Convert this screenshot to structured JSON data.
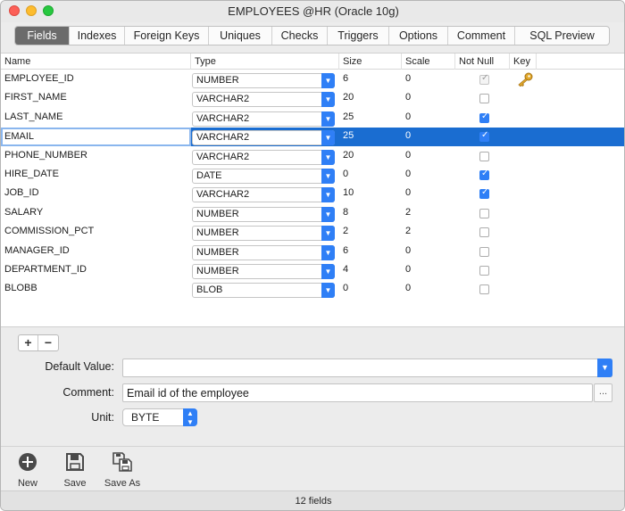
{
  "window": {
    "title": "EMPLOYEES @HR (Oracle 10g)"
  },
  "tabs": [
    {
      "label": "Fields"
    },
    {
      "label": "Indexes"
    },
    {
      "label": "Foreign Keys"
    },
    {
      "label": "Uniques"
    },
    {
      "label": "Checks"
    },
    {
      "label": "Triggers"
    },
    {
      "label": "Options"
    },
    {
      "label": "Comment"
    },
    {
      "label": "SQL Preview"
    }
  ],
  "active_tab": "Fields",
  "grid": {
    "headers": {
      "name": "Name",
      "type": "Type",
      "size": "Size",
      "scale": "Scale",
      "not_null": "Not Null",
      "key": "Key"
    },
    "rows": [
      {
        "name": "EMPLOYEE_ID",
        "type": "NUMBER",
        "size": "6",
        "scale": "0",
        "not_null": true,
        "disabled": true,
        "key": true,
        "selected": false
      },
      {
        "name": "FIRST_NAME",
        "type": "VARCHAR2",
        "size": "20",
        "scale": "0",
        "not_null": false,
        "key": false,
        "selected": false
      },
      {
        "name": "LAST_NAME",
        "type": "VARCHAR2",
        "size": "25",
        "scale": "0",
        "not_null": true,
        "key": false,
        "selected": false
      },
      {
        "name": "EMAIL",
        "type": "VARCHAR2",
        "size": "25",
        "scale": "0",
        "not_null": true,
        "key": false,
        "selected": true
      },
      {
        "name": "PHONE_NUMBER",
        "type": "VARCHAR2",
        "size": "20",
        "scale": "0",
        "not_null": false,
        "key": false,
        "selected": false
      },
      {
        "name": "HIRE_DATE",
        "type": "DATE",
        "size": "0",
        "scale": "0",
        "not_null": true,
        "key": false,
        "selected": false
      },
      {
        "name": "JOB_ID",
        "type": "VARCHAR2",
        "size": "10",
        "scale": "0",
        "not_null": true,
        "key": false,
        "selected": false
      },
      {
        "name": "SALARY",
        "type": "NUMBER",
        "size": "8",
        "scale": "2",
        "not_null": false,
        "key": false,
        "selected": false
      },
      {
        "name": "COMMISSION_PCT",
        "type": "NUMBER",
        "size": "2",
        "scale": "2",
        "not_null": false,
        "key": false,
        "selected": false
      },
      {
        "name": "MANAGER_ID",
        "type": "NUMBER",
        "size": "6",
        "scale": "0",
        "not_null": false,
        "key": false,
        "selected": false
      },
      {
        "name": "DEPARTMENT_ID",
        "type": "NUMBER",
        "size": "4",
        "scale": "0",
        "not_null": false,
        "key": false,
        "selected": false
      },
      {
        "name": "BLOBB",
        "type": "BLOB",
        "size": "0",
        "scale": "0",
        "not_null": false,
        "key": false,
        "selected": false
      }
    ]
  },
  "properties": {
    "default_value_label": "Default Value:",
    "default_value": "",
    "comment_label": "Comment:",
    "comment_value": "Email id of the employee",
    "unit_label": "Unit:",
    "unit_value": "BYTE",
    "ellipsis": "..."
  },
  "controls": {
    "add": "+",
    "remove": "−"
  },
  "toolbar": {
    "new_label": "New",
    "save_label": "Save",
    "save_as_label": "Save As"
  },
  "status": {
    "text": "12 fields"
  },
  "colors": {
    "selection": "#1a6dd1",
    "accent": "#2f7ff6",
    "active_tab": "#6b6b6b"
  }
}
